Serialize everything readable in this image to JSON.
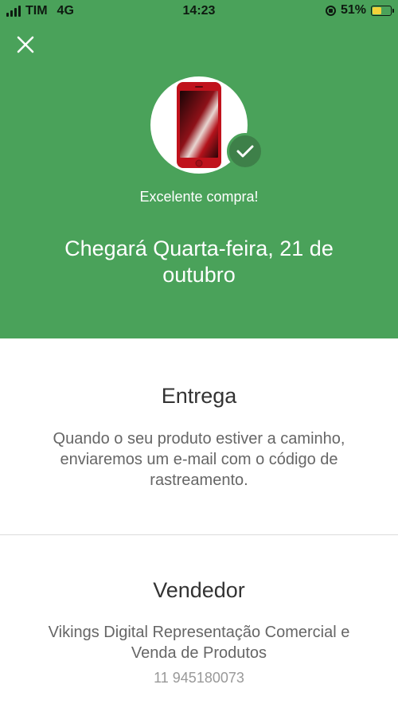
{
  "status_bar": {
    "carrier": "TIM",
    "network": "4G",
    "time": "14:23",
    "battery_percent": "51%",
    "battery_level": 0.51
  },
  "header": {
    "close_icon": "close-icon",
    "background_color": "#4aa25a",
    "product_image": "iphone-red",
    "check_icon": "check-icon",
    "confirmation_text": "Excelente compra!",
    "arrival_text": "Chegará Quarta-feira, 21 de outubro"
  },
  "delivery": {
    "title": "Entrega",
    "description": "Quando o seu produto estiver a caminho, enviaremos um e-mail com o código de rastreamento."
  },
  "seller": {
    "title": "Vendedor",
    "name": "Vikings Digital Representação Comercial e Venda de Produtos",
    "phone": "11 945180073"
  }
}
